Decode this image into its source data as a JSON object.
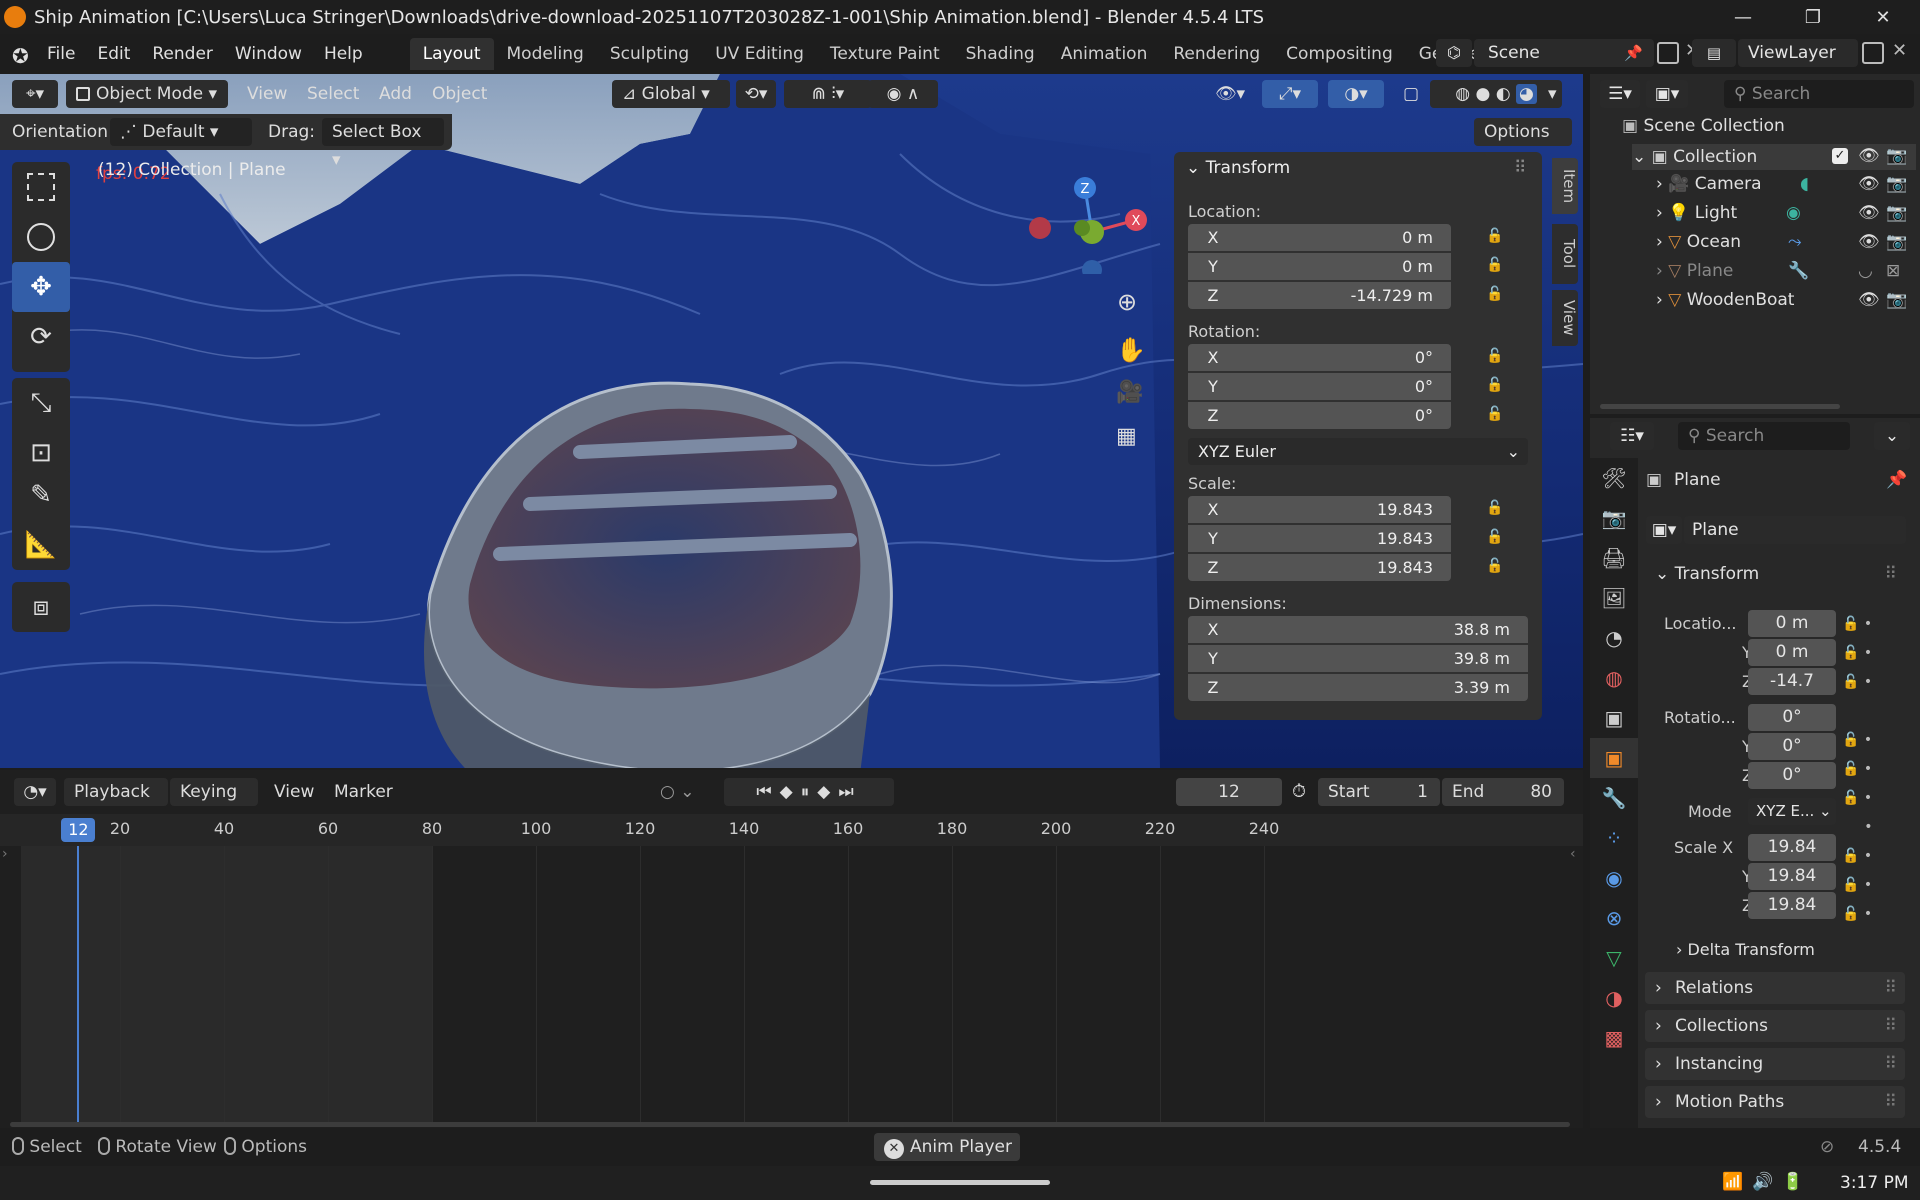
{
  "window": {
    "title": "Ship Animation [C:\\Users\\Luca Stringer\\Downloads\\drive-download-20251107T203028Z-1-001\\Ship Animation.blend] - Blender 4.5.4 LTS",
    "minimize": "—",
    "maximize": "❐",
    "close": "✕"
  },
  "menus": [
    "File",
    "Edit",
    "Render",
    "Window",
    "Help"
  ],
  "workspaces": [
    "Layout",
    "Modeling",
    "Sculpting",
    "UV Editing",
    "Texture Paint",
    "Shading",
    "Animation",
    "Rendering",
    "Compositing",
    "Geome"
  ],
  "scene": "Scene",
  "view_layer": "ViewLayer",
  "viewport": {
    "mode": "Object Mode",
    "menu": [
      "View",
      "Select",
      "Add",
      "Object"
    ],
    "transform_orientation": "Global",
    "orientation_label": "Orientation:",
    "orientation_value": "Default",
    "drag_label": "Drag:",
    "drag_value": "Select Box",
    "options": "Options",
    "fps": "fps: 0.72",
    "info": "(12) Collection | Plane",
    "gizmo": {
      "z": "Z",
      "x": "X"
    }
  },
  "transform_panel": {
    "title": "Transform",
    "location_label": "Location:",
    "location": [
      {
        "axis": "X",
        "value": "0 m"
      },
      {
        "axis": "Y",
        "value": "0 m"
      },
      {
        "axis": "Z",
        "value": "-14.729 m"
      }
    ],
    "rotation_label": "Rotation:",
    "rotation": [
      {
        "axis": "X",
        "value": "0°"
      },
      {
        "axis": "Y",
        "value": "0°"
      },
      {
        "axis": "Z",
        "value": "0°"
      }
    ],
    "rotation_mode": "XYZ Euler",
    "scale_label": "Scale:",
    "scale": [
      {
        "axis": "X",
        "value": "19.843"
      },
      {
        "axis": "Y",
        "value": "19.843"
      },
      {
        "axis": "Z",
        "value": "19.843"
      }
    ],
    "dimensions_label": "Dimensions:",
    "dimensions": [
      {
        "axis": "X",
        "value": "38.8 m"
      },
      {
        "axis": "Y",
        "value": "39.8 m"
      },
      {
        "axis": "Z",
        "value": "3.39 m"
      }
    ]
  },
  "side_tabs": [
    "Item",
    "Tool",
    "View"
  ],
  "outliner": {
    "search_placeholder": "Search",
    "root": "Scene Collection",
    "collection": "Collection",
    "items": [
      "Camera",
      "Light",
      "Ocean",
      "Plane",
      "WoodenBoat"
    ]
  },
  "properties": {
    "search_placeholder": "Search",
    "object_name": "Plane",
    "data_name": "Plane",
    "transform_title": "Transform",
    "location_label": "Locatio...",
    "location": [
      "0 m",
      "0 m",
      "-14.7"
    ],
    "rotation_label": "Rotatio...",
    "rotation": [
      "0°",
      "0°",
      "0°"
    ],
    "axis_y": "Y",
    "axis_z": "Z",
    "mode_label": "Mode",
    "mode_value": "XYZ E...",
    "scale_label": "Scale X",
    "scale": [
      "19.84",
      "19.84",
      "19.84"
    ],
    "delta": "Delta Transform",
    "sections": [
      "Relations",
      "Collections",
      "Instancing",
      "Motion Paths"
    ]
  },
  "timeline": {
    "menu": [
      "Playback",
      "Keying",
      "View",
      "Marker"
    ],
    "current_frame": "12",
    "start_label": "Start",
    "start": "1",
    "end_label": "End",
    "end": "80",
    "ruler": [
      "20",
      "40",
      "60",
      "80",
      "100",
      "120",
      "140",
      "160",
      "180",
      "200",
      "220",
      "240"
    ],
    "ruler_frames": [
      20,
      40,
      60,
      80,
      100,
      120,
      140,
      160,
      180,
      200,
      220,
      240
    ],
    "playhead_frame": 12
  },
  "statusbar": {
    "select": "Select",
    "rotate": "Rotate View",
    "options": "Options",
    "anim_player": "Anim Player",
    "version": "4.5.4"
  },
  "taskbar": {
    "time": "3:17 PM"
  }
}
